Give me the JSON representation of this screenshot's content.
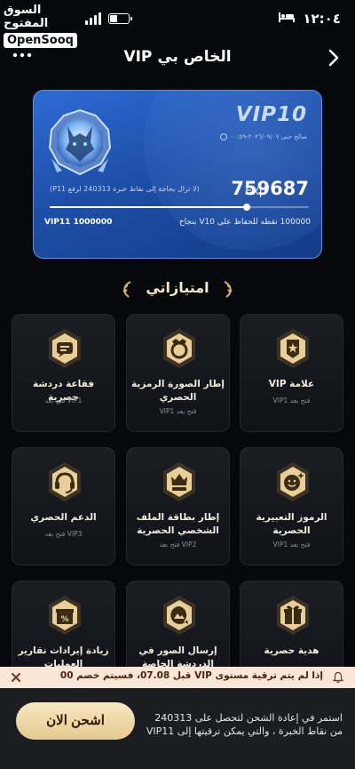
{
  "status": {
    "time": "١٢:٠٤"
  },
  "watermark": {
    "arabic": "السوق المفتوح",
    "english": "OpenSooq"
  },
  "header": {
    "title": "VIP الخاص بي"
  },
  "vip_card": {
    "level": "VIP10",
    "validity": "صالح حتى ٢٠٢٦/٠٩/٠٧-٠٠:٥٩",
    "exp_label": "Exp",
    "exp_value": "759687",
    "exp_hint": "(لا تزال بحاجة إلى نقاط خبرة 240313 لرفع P11)",
    "progress_fraction": 0.76,
    "next_target": "VIP11 1000000",
    "maintain_text": "100000 نقطه للحفاظ على V10 بنجاح"
  },
  "section": {
    "title": "امتيازاتي"
  },
  "privileges": [
    {
      "name": "علامة VIP",
      "unlock": "فتح بعد VIP1",
      "icon": "vip-badge-icon"
    },
    {
      "name": "إطار الصورة الرمزية الحصري",
      "unlock": "فتح بعد VIP1",
      "icon": "avatar-frame-icon"
    },
    {
      "name": "فقاعة دردشة حصرية",
      "unlock": "VIP1 فتح بعد",
      "icon": "chat-bubble-icon"
    },
    {
      "name": "الرموز التعبيرية الحصرية",
      "unlock": "فتح بعد VIP1",
      "icon": "emoji-icon"
    },
    {
      "name": "إطار بطاقة الملف الشخصي الحصرية",
      "unlock": "VIP2 فتح بعد",
      "icon": "profile-card-frame-icon"
    },
    {
      "name": "الدعم الحصري",
      "unlock": "VIP3 فتح بعد",
      "icon": "headset-icon"
    },
    {
      "name": "هدية حصرية",
      "unlock": "",
      "icon": "gift-icon"
    },
    {
      "name": "إرسال الصور في الدردشة الخاصة",
      "unlock": "",
      "icon": "photo-chat-icon"
    },
    {
      "name": "زيادة إيرادات تقارير العمليات",
      "unlock": "",
      "icon": "revenue-gift-icon"
    }
  ],
  "notice": {
    "text": "إذا لم يتم ترقية مستوى VIP قبل 07.08، فسيتم خصم 00"
  },
  "bottom": {
    "recharge_label": "اشحن الان",
    "text": "استمر في إعادة الشحن لتحصل على 240313 من نقاط الخبرة ، والتي يمكن ترقيتها إلى VIP11"
  },
  "colors": {
    "card_blue": "#1d4fa8",
    "gold": "#e6c98e",
    "notice_bg": "#fbe6d7",
    "background": "#07080b"
  }
}
